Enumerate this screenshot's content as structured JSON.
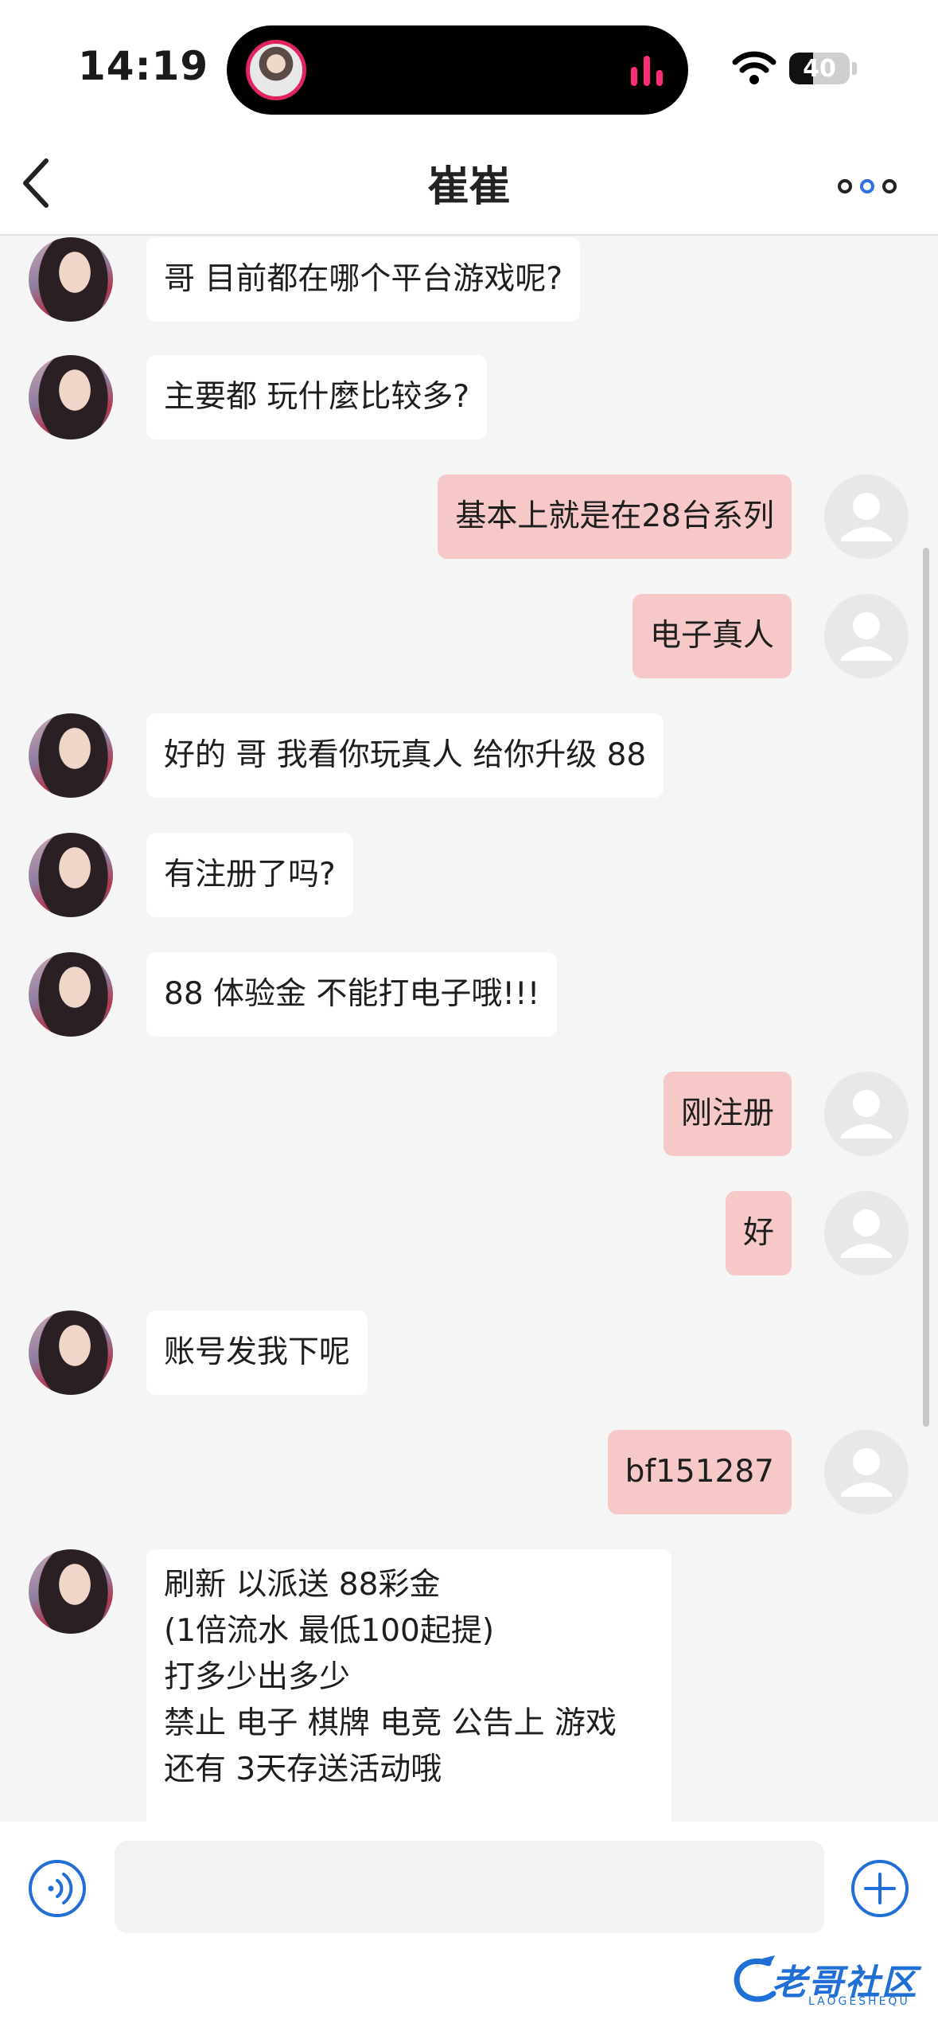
{
  "status": {
    "time": "14:19",
    "battery": "40",
    "battery_level": 0.4
  },
  "nav": {
    "title": "崔崔"
  },
  "colors": {
    "outgoing_bubble": "#f6c8c8",
    "incoming_bubble": "#ffffff",
    "accent": "#1f6fd6"
  },
  "messages": [
    {
      "side": "in",
      "text": "哥 目前都在哪个平台游戏呢?"
    },
    {
      "side": "in",
      "text": "主要都 玩什麼比较多?"
    },
    {
      "side": "out",
      "text": "基本上就是在28台系列"
    },
    {
      "side": "out",
      "text": "电子真人"
    },
    {
      "side": "in",
      "text": "好的  哥 我看你玩真人 给你升级 88"
    },
    {
      "side": "in",
      "text": "有注册了吗?"
    },
    {
      "side": "in",
      "text": "88 体验金 不能打电子哦!!!"
    },
    {
      "side": "out",
      "text": "刚注册"
    },
    {
      "side": "out",
      "text": "好"
    },
    {
      "side": "in",
      "text": "账号发我下呢"
    },
    {
      "side": "out",
      "text": "bf151287"
    },
    {
      "side": "in",
      "lines": [
        "刷新 以派送  88彩金",
        "(1倍流水 最低100起提)",
        "打多少出多少",
        "禁止 电子 棋牌 电竞 公告上 游戏",
        "还有 3天存送活动哦"
      ]
    }
  ],
  "input": {
    "placeholder": ""
  },
  "watermark": {
    "text": "老哥社区",
    "sub": "LAOGESHEQU"
  }
}
